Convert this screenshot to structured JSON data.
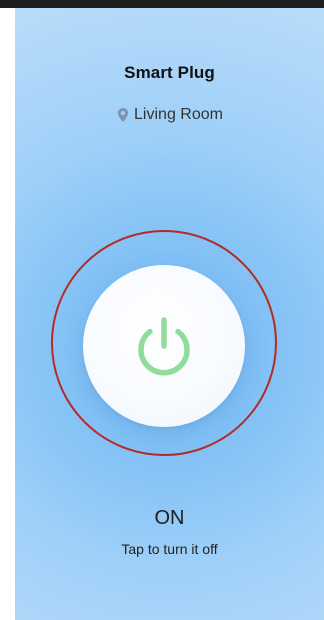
{
  "device": {
    "title": "Smart Plug",
    "location": "Living Room",
    "state_text": "ON",
    "hint_text": "Tap to turn it off"
  },
  "icons": {
    "location": "location-pin-icon",
    "power": "power-icon"
  },
  "colors": {
    "power_icon": "#8fdc9c",
    "highlight_ring": "#b42b26",
    "background_accent": "#86c3f6"
  }
}
